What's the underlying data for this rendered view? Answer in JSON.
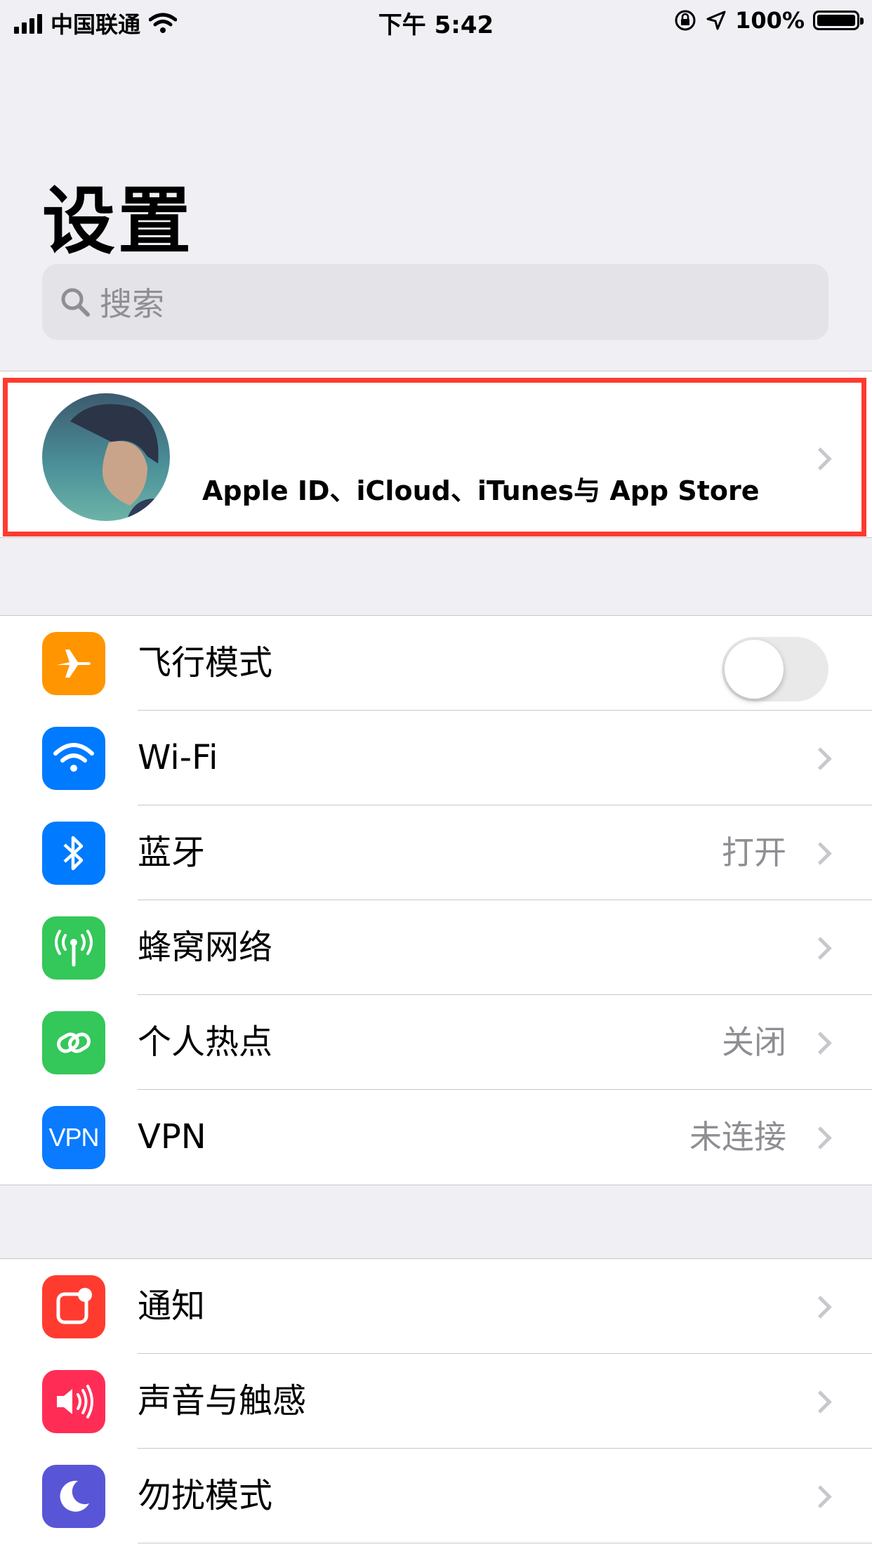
{
  "status_bar": {
    "carrier": "中国联通",
    "time": "下午 5:42",
    "battery": "100%",
    "battery_level": 1.0
  },
  "page": {
    "title": "设置",
    "search_placeholder": "搜索"
  },
  "profile": {
    "subtitle": "Apple ID、iCloud、iTunes与 App Store"
  },
  "group1": [
    {
      "label": "飞行模式",
      "icon": "airplane-icon",
      "color": "#ff9500",
      "toggle": false
    },
    {
      "label": "Wi-Fi",
      "icon": "wifi-icon",
      "color": "#007aff"
    },
    {
      "label": "蓝牙",
      "icon": "bluetooth-icon",
      "color": "#007aff",
      "value": "打开"
    },
    {
      "label": "蜂窝网络",
      "icon": "cellular-icon",
      "color": "#34c759"
    },
    {
      "label": "个人热点",
      "icon": "hotspot-icon",
      "color": "#34c759",
      "value": "关闭"
    },
    {
      "label": "VPN",
      "icon": "vpn-icon",
      "color": "#0a7aff",
      "value": "未连接",
      "icon_text": "VPN"
    }
  ],
  "group2": [
    {
      "label": "通知",
      "icon": "notifications-icon",
      "color": "#ff3b30"
    },
    {
      "label": "声音与触感",
      "icon": "sound-icon",
      "color": "#ff2d55"
    },
    {
      "label": "勿扰模式",
      "icon": "moon-icon",
      "color": "#5856d6"
    }
  ]
}
